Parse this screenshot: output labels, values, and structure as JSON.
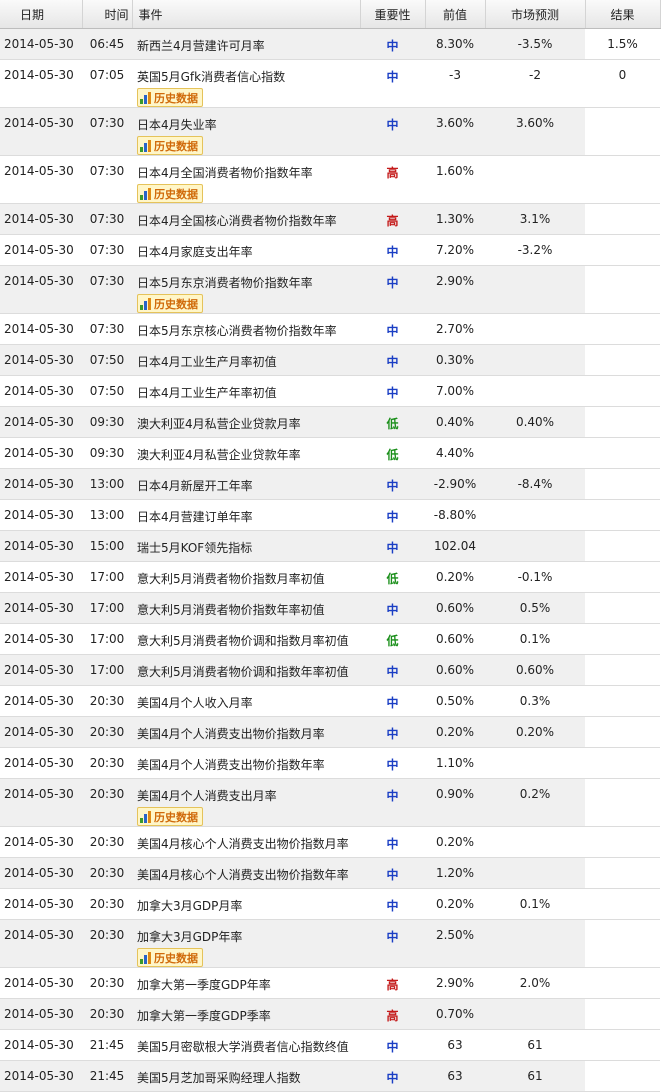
{
  "header": {
    "date": "日期",
    "time": "时间",
    "event": "事件",
    "importance": "重要性",
    "previous": "前值",
    "forecast": "市场预测",
    "result": "结果"
  },
  "history_label": "历史数据",
  "rows": [
    {
      "date": "2014-05-30",
      "time": "06:45",
      "event": "新西兰4月营建许可月率",
      "importance": "中",
      "previous": "8.30%",
      "forecast": "-3.5%",
      "result": "1.5%",
      "history": false
    },
    {
      "date": "2014-05-30",
      "time": "07:05",
      "event": "英国5月Gfk消费者信心指数",
      "importance": "中",
      "previous": "-3",
      "forecast": "-2",
      "result": "0",
      "history": true
    },
    {
      "date": "2014-05-30",
      "time": "07:30",
      "event": "日本4月失业率",
      "importance": "中",
      "previous": "3.60%",
      "forecast": "3.60%",
      "result": "",
      "history": true
    },
    {
      "date": "2014-05-30",
      "time": "07:30",
      "event": "日本4月全国消费者物价指数年率",
      "importance": "高",
      "previous": "1.60%",
      "forecast": "",
      "result": "",
      "history": true
    },
    {
      "date": "2014-05-30",
      "time": "07:30",
      "event": "日本4月全国核心消费者物价指数年率",
      "importance": "高",
      "previous": "1.30%",
      "forecast": "3.1%",
      "result": "",
      "history": false
    },
    {
      "date": "2014-05-30",
      "time": "07:30",
      "event": "日本4月家庭支出年率",
      "importance": "中",
      "previous": "7.20%",
      "forecast": "-3.2%",
      "result": "",
      "history": false
    },
    {
      "date": "2014-05-30",
      "time": "07:30",
      "event": "日本5月东京消费者物价指数年率",
      "importance": "中",
      "previous": "2.90%",
      "forecast": "",
      "result": "",
      "history": true
    },
    {
      "date": "2014-05-30",
      "time": "07:30",
      "event": "日本5月东京核心消费者物价指数年率",
      "importance": "中",
      "previous": "2.70%",
      "forecast": "",
      "result": "",
      "history": false
    },
    {
      "date": "2014-05-30",
      "time": "07:50",
      "event": "日本4月工业生产月率初值",
      "importance": "中",
      "previous": "0.30%",
      "forecast": "",
      "result": "",
      "history": false
    },
    {
      "date": "2014-05-30",
      "time": "07:50",
      "event": "日本4月工业生产年率初值",
      "importance": "中",
      "previous": "7.00%",
      "forecast": "",
      "result": "",
      "history": false
    },
    {
      "date": "2014-05-30",
      "time": "09:30",
      "event": "澳大利亚4月私营企业贷款月率",
      "importance": "低",
      "previous": "0.40%",
      "forecast": "0.40%",
      "result": "",
      "history": false
    },
    {
      "date": "2014-05-30",
      "time": "09:30",
      "event": "澳大利亚4月私营企业贷款年率",
      "importance": "低",
      "previous": "4.40%",
      "forecast": "",
      "result": "",
      "history": false
    },
    {
      "date": "2014-05-30",
      "time": "13:00",
      "event": "日本4月新屋开工年率",
      "importance": "中",
      "previous": "-2.90%",
      "forecast": "-8.4%",
      "result": "",
      "history": false
    },
    {
      "date": "2014-05-30",
      "time": "13:00",
      "event": "日本4月营建订单年率",
      "importance": "中",
      "previous": "-8.80%",
      "forecast": "",
      "result": "",
      "history": false
    },
    {
      "date": "2014-05-30",
      "time": "15:00",
      "event": "瑞士5月KOF领先指标",
      "importance": "中",
      "previous": "102.04",
      "forecast": "",
      "result": "",
      "history": false
    },
    {
      "date": "2014-05-30",
      "time": "17:00",
      "event": "意大利5月消费者物价指数月率初值",
      "importance": "低",
      "previous": "0.20%",
      "forecast": "-0.1%",
      "result": "",
      "history": false
    },
    {
      "date": "2014-05-30",
      "time": "17:00",
      "event": "意大利5月消费者物价指数年率初值",
      "importance": "中",
      "previous": "0.60%",
      "forecast": "0.5%",
      "result": "",
      "history": false
    },
    {
      "date": "2014-05-30",
      "time": "17:00",
      "event": "意大利5月消费者物价调和指数月率初值",
      "importance": "低",
      "previous": "0.60%",
      "forecast": "0.1%",
      "result": "",
      "history": false
    },
    {
      "date": "2014-05-30",
      "time": "17:00",
      "event": "意大利5月消费者物价调和指数年率初值",
      "importance": "中",
      "previous": "0.60%",
      "forecast": "0.60%",
      "result": "",
      "history": false
    },
    {
      "date": "2014-05-30",
      "time": "20:30",
      "event": "美国4月个人收入月率",
      "importance": "中",
      "previous": "0.50%",
      "forecast": "0.3%",
      "result": "",
      "history": false
    },
    {
      "date": "2014-05-30",
      "time": "20:30",
      "event": "美国4月个人消费支出物价指数月率",
      "importance": "中",
      "previous": "0.20%",
      "forecast": "0.20%",
      "result": "",
      "history": false
    },
    {
      "date": "2014-05-30",
      "time": "20:30",
      "event": "美国4月个人消费支出物价指数年率",
      "importance": "中",
      "previous": "1.10%",
      "forecast": "",
      "result": "",
      "history": false
    },
    {
      "date": "2014-05-30",
      "time": "20:30",
      "event": "美国4月个人消费支出月率",
      "importance": "中",
      "previous": "0.90%",
      "forecast": "0.2%",
      "result": "",
      "history": true
    },
    {
      "date": "2014-05-30",
      "time": "20:30",
      "event": "美国4月核心个人消费支出物价指数月率",
      "importance": "中",
      "previous": "0.20%",
      "forecast": "",
      "result": "",
      "history": false
    },
    {
      "date": "2014-05-30",
      "time": "20:30",
      "event": "美国4月核心个人消费支出物价指数年率",
      "importance": "中",
      "previous": "1.20%",
      "forecast": "",
      "result": "",
      "history": false
    },
    {
      "date": "2014-05-30",
      "time": "20:30",
      "event": "加拿大3月GDP月率",
      "importance": "中",
      "previous": "0.20%",
      "forecast": "0.1%",
      "result": "",
      "history": false
    },
    {
      "date": "2014-05-30",
      "time": "20:30",
      "event": "加拿大3月GDP年率",
      "importance": "中",
      "previous": "2.50%",
      "forecast": "",
      "result": "",
      "history": true
    },
    {
      "date": "2014-05-30",
      "time": "20:30",
      "event": "加拿大第一季度GDP年率",
      "importance": "高",
      "previous": "2.90%",
      "forecast": "2.0%",
      "result": "",
      "history": false
    },
    {
      "date": "2014-05-30",
      "time": "20:30",
      "event": "加拿大第一季度GDP季率",
      "importance": "高",
      "previous": "0.70%",
      "forecast": "",
      "result": "",
      "history": false
    },
    {
      "date": "2014-05-30",
      "time": "21:45",
      "event": "美国5月密歇根大学消费者信心指数终值",
      "importance": "中",
      "previous": "63",
      "forecast": "61",
      "result": "",
      "history": false
    },
    {
      "date": "2014-05-30",
      "time": "21:45",
      "event": "美国5月芝加哥采购经理人指数",
      "importance": "中",
      "previous": "63",
      "forecast": "61",
      "result": "",
      "history": false
    }
  ]
}
